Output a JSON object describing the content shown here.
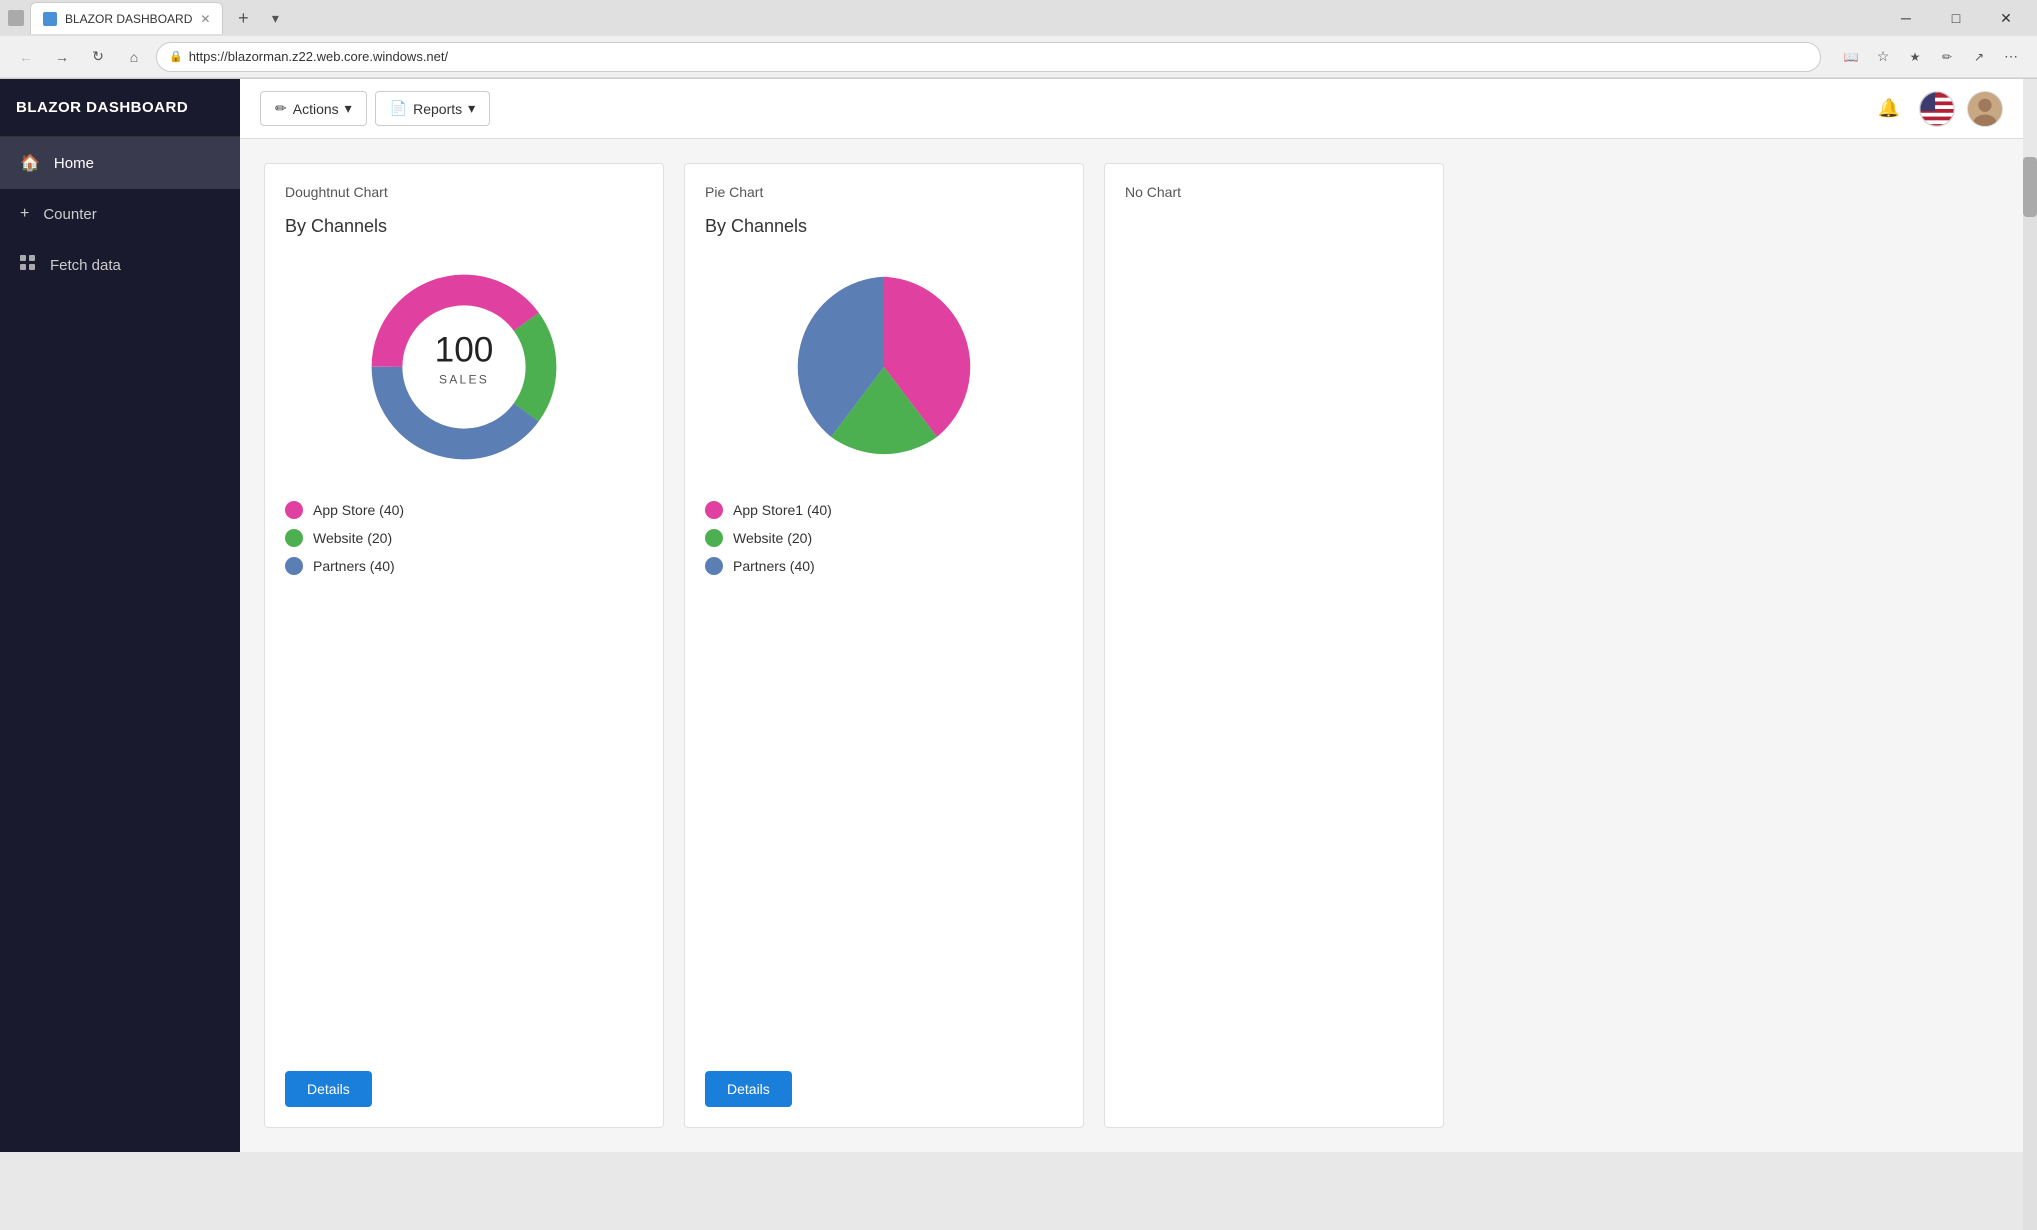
{
  "browser": {
    "tab_title": "BLAZOR DASHBOARD",
    "url": "https://blazorman.z22.web.core.windows.net/",
    "new_tab_label": "+",
    "win_minimize": "─",
    "win_maximize": "□",
    "win_close": "✕"
  },
  "app": {
    "title": "BLAZOR DASHBOARD",
    "toolbar": {
      "actions_label": "Actions",
      "reports_label": "Reports"
    },
    "sidebar": {
      "items": [
        {
          "id": "home",
          "label": "Home",
          "icon": "🏠",
          "active": true
        },
        {
          "id": "counter",
          "label": "Counter",
          "icon": "➕"
        },
        {
          "id": "fetch",
          "label": "Fetch data",
          "icon": "▦"
        }
      ]
    },
    "charts": {
      "donut": {
        "title": "Doughtnut Chart",
        "subtitle": "By Channels",
        "center_number": "100",
        "center_label": "SALES",
        "legend": [
          {
            "label": "App Store (40)",
            "color": "#e040a0"
          },
          {
            "label": "Website (20)",
            "color": "#4caf50"
          },
          {
            "label": "Partners (40)",
            "color": "#5b7eb5"
          }
        ],
        "details_btn": "Details",
        "segments": [
          {
            "value": 40,
            "color": "#e040a0"
          },
          {
            "value": 20,
            "color": "#4caf50"
          },
          {
            "value": 40,
            "color": "#5b7eb5"
          }
        ]
      },
      "pie": {
        "title": "Pie Chart",
        "subtitle": "By Channels",
        "legend": [
          {
            "label": "App Store1 (40)",
            "color": "#e040a0"
          },
          {
            "label": "Website (20)",
            "color": "#4caf50"
          },
          {
            "label": "Partners (40)",
            "color": "#5b7eb5"
          }
        ],
        "details_btn": "Details",
        "segments": [
          {
            "value": 40,
            "color": "#e040a0"
          },
          {
            "value": 20,
            "color": "#4caf50"
          },
          {
            "value": 40,
            "color": "#5b7eb5"
          }
        ]
      },
      "nochart": {
        "title": "No Chart",
        "subtitle": ""
      }
    }
  }
}
